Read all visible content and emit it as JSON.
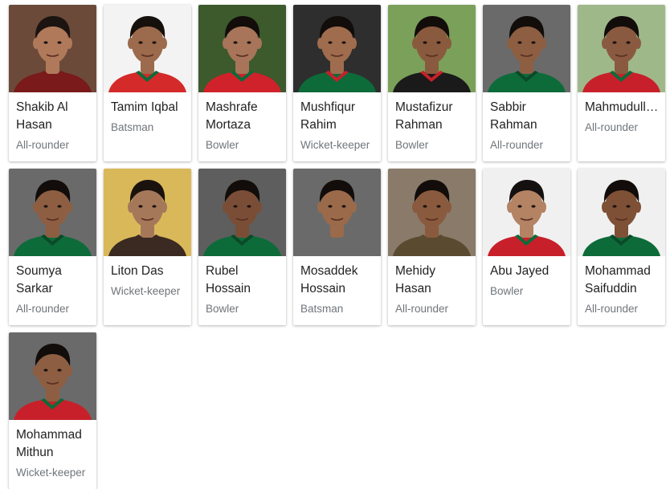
{
  "players": [
    {
      "name": "Shakib Al Hasan",
      "role": "All-rounder",
      "bg": "#6b4a3a",
      "shirt": "#7a1a1a",
      "trim": "#7a1a1a",
      "skin": "#b07a5a",
      "hair": "#1c1410"
    },
    {
      "name": "Tamim Iqbal",
      "role": "Batsman",
      "bg": "#f3f3f3",
      "shirt": "#d42a2a",
      "trim": "#0b6b3a",
      "skin": "#9c6a4c",
      "hair": "#15100c"
    },
    {
      "name": "Mashrafe Mortaza",
      "role": "Bowler",
      "bg": "#3c5a2c",
      "shirt": "#d0222a",
      "trim": "#0b6b3a",
      "skin": "#a8755a",
      "hair": "#120d0a"
    },
    {
      "name": "Mushfiqur Rahim",
      "role": "Wicket-keeper",
      "bg": "#2e2e2e",
      "shirt": "#0d6b3a",
      "trim": "#c8202a",
      "skin": "#a06c4e",
      "hair": "#120d0a"
    },
    {
      "name": "Mustafizur Rahman",
      "role": "Bowler",
      "bg": "#7aa05a",
      "shirt": "#1a1a1a",
      "trim": "#c8202a",
      "skin": "#8a5a3e",
      "hair": "#120d0a"
    },
    {
      "name": "Sabbir Rahman",
      "role": "All-rounder",
      "bg": "#6a6a6a",
      "shirt": "#0d6b3a",
      "trim": "#0a4a28",
      "skin": "#8e5e42",
      "hair": "#120d0a"
    },
    {
      "name": "Mahmudullah Riyad",
      "role": "All-rounder",
      "bg": "#9fb88a",
      "shirt": "#c8202a",
      "trim": "#0d6b3a",
      "skin": "#8a5a40",
      "hair": "#120d0a"
    },
    {
      "name": "Soumya Sarkar",
      "role": "All-rounder",
      "bg": "#6a6a6a",
      "shirt": "#0d6b3a",
      "trim": "#0a4a28",
      "skin": "#8e5e42",
      "hair": "#120d0a"
    },
    {
      "name": "Liton Das",
      "role": "Wicket-keeper",
      "bg": "#d9b85a",
      "shirt": "#3a2a22",
      "trim": "#3a2a22",
      "skin": "#a6785a",
      "hair": "#1a120c"
    },
    {
      "name": "Rubel Hossain",
      "role": "Bowler",
      "bg": "#5e5e5e",
      "shirt": "#0d6b3a",
      "trim": "#0a4a28",
      "skin": "#7a4e36",
      "hair": "#120d0a"
    },
    {
      "name": "Mosaddek Hossain",
      "role": "Batsman",
      "bg": "#6a6a6a",
      "shirt": "#6a6a6a",
      "trim": "#6a6a6a",
      "skin": "#9a6a4a",
      "hair": "#120d0a"
    },
    {
      "name": "Mehidy Hasan",
      "role": "All-rounder",
      "bg": "#8a7a6a",
      "shirt": "#5a4a30",
      "trim": "#5a4a30",
      "skin": "#8a5a3e",
      "hair": "#120d0a"
    },
    {
      "name": "Abu Jayed",
      "role": "Bowler",
      "bg": "#f0f0f0",
      "shirt": "#c8202a",
      "trim": "#0d6b3a",
      "skin": "#b38364",
      "hair": "#151010"
    },
    {
      "name": "Mohammad Saifuddin",
      "role": "All-rounder",
      "bg": "#f0f0f0",
      "shirt": "#0d6b3a",
      "trim": "#0a4a28",
      "skin": "#7e5036",
      "hair": "#120d0a"
    },
    {
      "name": "Mohammad Mithun",
      "role": "Wicket-keeper",
      "bg": "#6a6a6a",
      "shirt": "#c8202a",
      "trim": "#0d6b3a",
      "skin": "#8e5e42",
      "hair": "#120d0a"
    }
  ]
}
